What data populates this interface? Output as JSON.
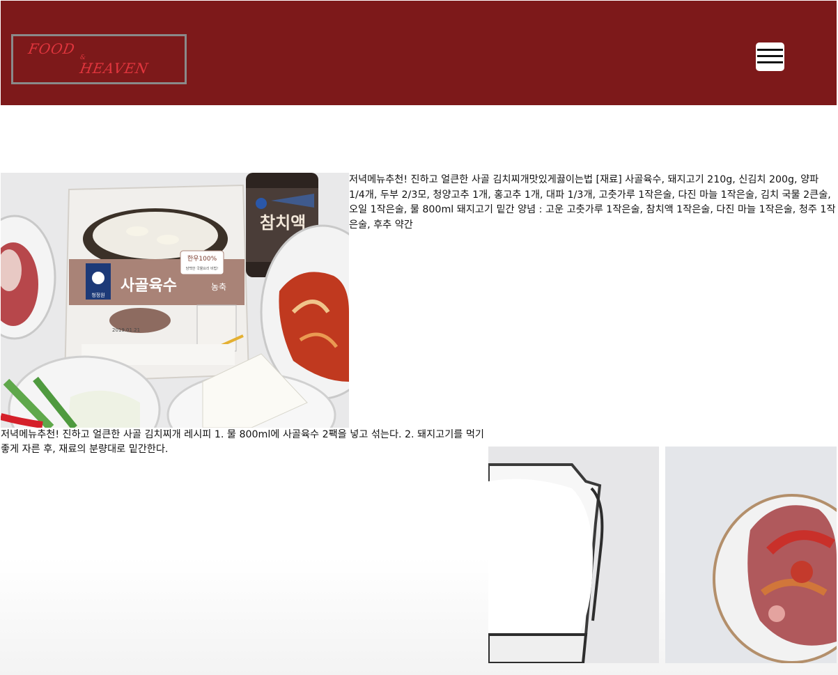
{
  "header": {
    "logo_line1": "FOOD",
    "logo_amp": "&",
    "logo_line2": "HEAVEN",
    "menu_icon": "hamburger-menu-icon",
    "background_color": "#7d191a",
    "logo_color": "#e0353d"
  },
  "photos": {
    "main": {
      "pouch_brand": "청정원",
      "pouch_title": "사골육수",
      "pouch_sub": "농축",
      "pouch_badge": "한우100%",
      "pouch_badge_sub": "담백한 국물요리 비법!",
      "pouch_date": "2019.01.21",
      "bottle_label": "참치액"
    }
  },
  "content": {
    "intro": "저녁메뉴추천! 진하고 얼큰한 사골 김치찌개맛있게끓이는법 [재료] 사골육수, 돼지고기 210g, 신김치 200g, 양파 1/4개, 두부 2/3모, 청양고추 1개, 홍고추 1개, 대파 1/3개, 고춧가루 1작은술, 다진 마늘 1작은술, 김치 국물 2큰술, 오일 1작은술, 물 800ml 돼지고기 밑간 양념 : 고운 고춧가루 1작은술, 참치액 1작은술, 다진 마늘 1작은술, 청주 1작은술, 후추 약간",
    "steps": "저녁메뉴추천! 진하고 얼큰한 사골 김치찌개 레시피 1. 물 800ml에 사골육수 2팩을 넣고 섞는다. 2. 돼지고기를 먹기 좋게 자른 후, 재료의 분량대로 밑간한다."
  }
}
